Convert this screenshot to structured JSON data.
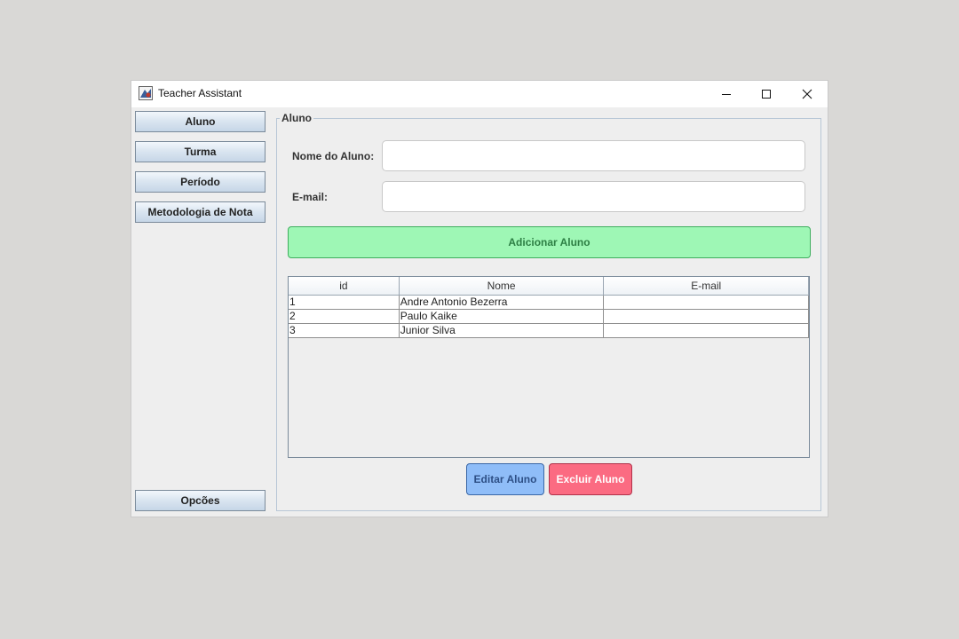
{
  "window": {
    "title": "Teacher Assistant"
  },
  "sidebar": {
    "items": [
      {
        "label": "Aluno"
      },
      {
        "label": "Turma"
      },
      {
        "label": "Período"
      },
      {
        "label": "Metodologia de Nota"
      }
    ],
    "options_label": "Opcões"
  },
  "panel": {
    "title": "Aluno",
    "name_label": "Nome do Aluno:",
    "name_value": "",
    "email_label": "E-mail:",
    "email_value": "",
    "add_button": "Adicionar Aluno",
    "edit_button": "Editar Aluno",
    "delete_button": "Excluir Aluno"
  },
  "table": {
    "columns": [
      "id",
      "Nome",
      "E-mail"
    ],
    "rows": [
      [
        "1",
        "Andre Antonio Bezerra",
        ""
      ],
      [
        "2",
        "Paulo Kaike",
        ""
      ],
      [
        "3",
        "Junior Silva",
        ""
      ]
    ]
  },
  "colors": {
    "add_button_bg": "#9ef7b5",
    "edit_button_bg": "#8fbdf8",
    "delete_button_bg": "#fb6b82"
  },
  "icons": {
    "app": "teacher-assistant-app-icon",
    "minimize": "minimize-icon",
    "maximize": "maximize-icon",
    "close": "close-icon"
  }
}
